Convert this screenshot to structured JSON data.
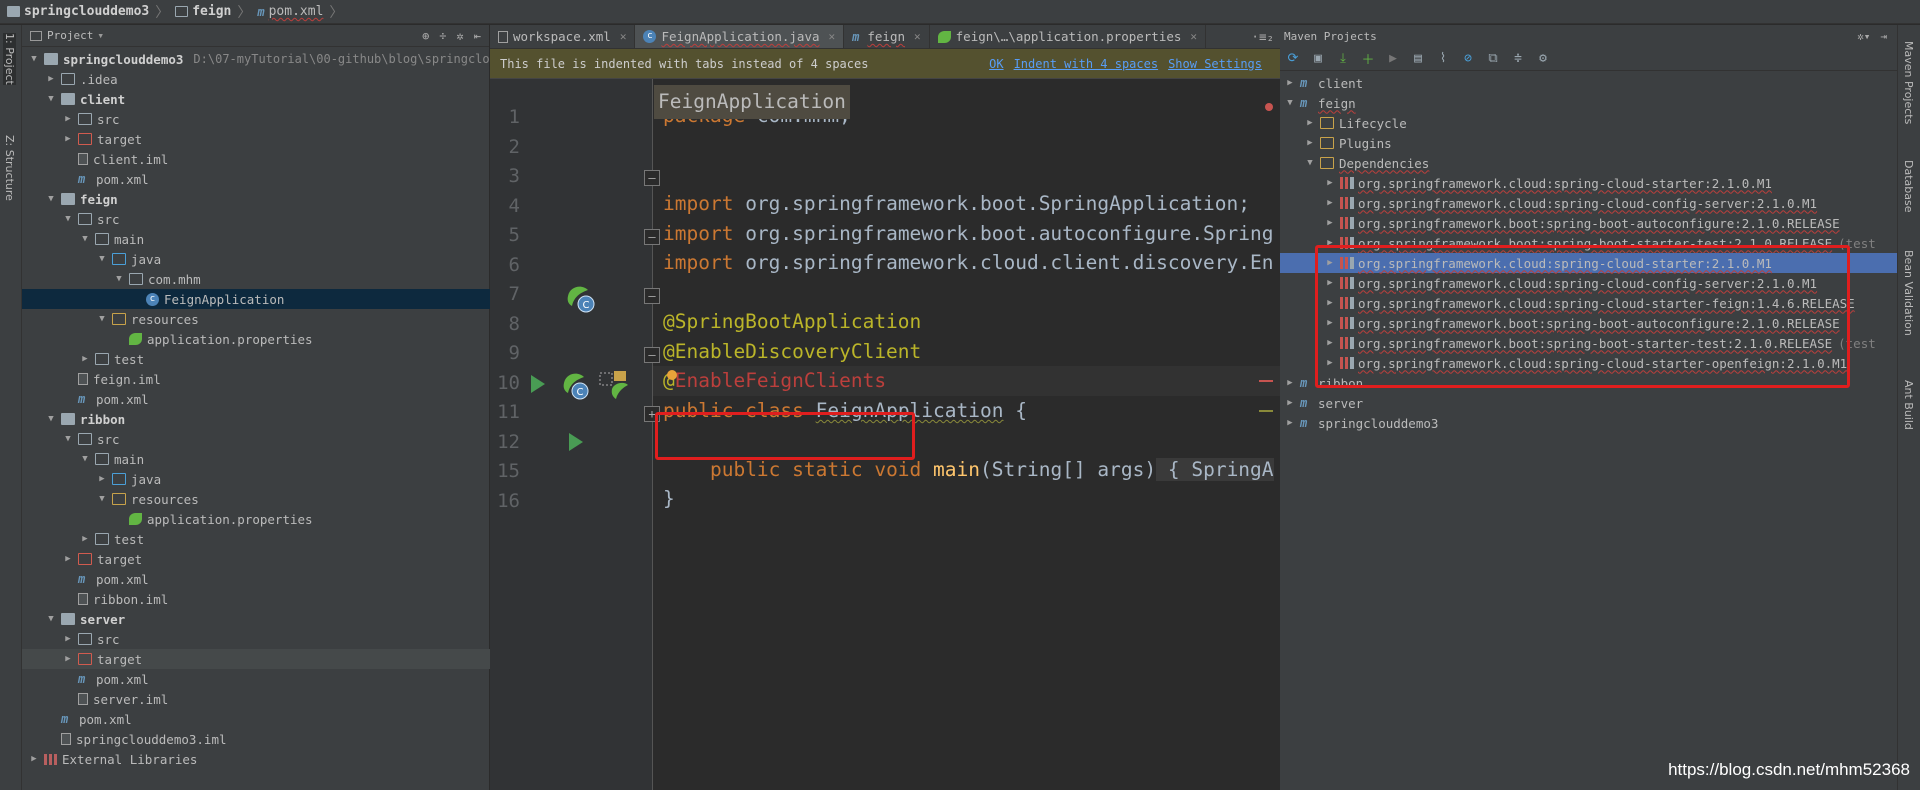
{
  "breadcrumb": [
    {
      "label": "springclouddemo3",
      "icon": "folder-icon"
    },
    {
      "label": "feign",
      "icon": "module-folder-icon"
    },
    {
      "label": "pom.xml",
      "icon": "maven-icon"
    }
  ],
  "left_stripe": {
    "project_tab": "1: Project",
    "structure_tab": "Z: Structure"
  },
  "project_panel": {
    "title": "Project",
    "root_path": "D:\\07-myTutorial\\00-github\\blog\\springclo",
    "rows": [
      {
        "label": "springclouddemo3",
        "bold": true,
        "arrow": "down",
        "icon": "module"
      },
      {
        "label": ".idea",
        "arrow": "right",
        "icon": "normal"
      },
      {
        "label": "client",
        "bold": true,
        "arrow": "down",
        "icon": "module"
      },
      {
        "label": "src",
        "arrow": "right",
        "icon": "normal"
      },
      {
        "label": "target",
        "arrow": "right",
        "icon": "target"
      },
      {
        "label": "client.iml",
        "icon": "iml"
      },
      {
        "label": "pom.xml",
        "icon": "mvn"
      },
      {
        "label": "feign",
        "bold": true,
        "arrow": "down",
        "icon": "module"
      },
      {
        "label": "src",
        "arrow": "down",
        "icon": "normal"
      },
      {
        "label": "main",
        "arrow": "down",
        "icon": "normal"
      },
      {
        "label": "java",
        "arrow": "down",
        "icon": "src"
      },
      {
        "label": "com.mhm",
        "arrow": "down",
        "icon": "normal"
      },
      {
        "label": "FeignApplication",
        "icon": "class"
      },
      {
        "label": "resources",
        "arrow": "down",
        "icon": "res"
      },
      {
        "label": "application.properties",
        "icon": "leaf"
      },
      {
        "label": "test",
        "arrow": "right",
        "icon": "test"
      },
      {
        "label": "feign.iml",
        "icon": "iml"
      },
      {
        "label": "pom.xml",
        "icon": "mvn"
      },
      {
        "label": "ribbon",
        "bold": true,
        "arrow": "down",
        "icon": "module"
      },
      {
        "label": "src",
        "arrow": "down",
        "icon": "normal"
      },
      {
        "label": "main",
        "arrow": "down",
        "icon": "normal"
      },
      {
        "label": "java",
        "arrow": "right",
        "icon": "src"
      },
      {
        "label": "resources",
        "arrow": "down",
        "icon": "res"
      },
      {
        "label": "application.properties",
        "icon": "leaf"
      },
      {
        "label": "test",
        "arrow": "right",
        "icon": "test"
      },
      {
        "label": "target",
        "arrow": "right",
        "icon": "target"
      },
      {
        "label": "pom.xml",
        "icon": "mvn"
      },
      {
        "label": "ribbon.iml",
        "icon": "iml"
      },
      {
        "label": "server",
        "bold": true,
        "arrow": "down",
        "icon": "module"
      },
      {
        "label": "src",
        "arrow": "right",
        "icon": "normal"
      },
      {
        "label": "target",
        "arrow": "right",
        "icon": "target"
      },
      {
        "label": "pom.xml",
        "icon": "mvn"
      },
      {
        "label": "server.iml",
        "icon": "iml"
      },
      {
        "label": "pom.xml",
        "icon": "mvn"
      },
      {
        "label": "springclouddemo3.iml",
        "icon": "iml"
      },
      {
        "label": "External Libraries",
        "arrow": "right",
        "icon": "lib"
      }
    ]
  },
  "editor": {
    "tabs": [
      {
        "label": "workspace.xml",
        "icon": "xml-icon",
        "active": false
      },
      {
        "label": "FeignApplication.java",
        "icon": "class-icon",
        "active": true
      },
      {
        "label": "feign",
        "icon": "maven-icon",
        "active": false
      },
      {
        "label": "feign\\…\\application.properties",
        "icon": "leaf-icon",
        "active": false
      }
    ],
    "tab_more": "·≡₂",
    "notice": {
      "text": "This file is indented with tabs instead of 4 spaces",
      "ok": "OK",
      "indent": "Indent with 4 spaces",
      "settings": "Show Settings"
    },
    "file_label": "FeignApplication",
    "line_numbers": [
      "1",
      "2",
      "3",
      "4",
      "5",
      "6",
      "7",
      "8",
      "9",
      "10",
      "11",
      "12",
      "15",
      "16"
    ],
    "code": {
      "l1_kw": "package",
      "l1_rest": " com.mhm;",
      "l3_kw": "import",
      "l3_rest": " org.springframework.boot.SpringApplication;",
      "l4_kw": "import",
      "l4_rest": " org.springframework.boot.autoconfigure.Spring",
      "l5_kw": "import",
      "l5_rest": " org.springframework.cloud.client.discovery.En",
      "l7": "@SpringBootApplication",
      "l8": "@EnableDiscoveryClient",
      "l9_at": "@",
      "l9_rest": "EnableFeignClients",
      "l10_kw": "public class",
      "l10_name": "FeignApplication",
      "l10_brace": " {",
      "l12_kw": "public static void",
      "l12_fn": "main",
      "l12_args": "(String[] args)",
      "l12_body": " { SpringA",
      "l15": "}"
    }
  },
  "maven_panel": {
    "title": "Maven Projects",
    "rows": [
      {
        "label": "client",
        "arrow": "right",
        "icon": "mvn",
        "indent": 0
      },
      {
        "label": "feign",
        "arrow": "down",
        "icon": "mvn",
        "indent": 0
      },
      {
        "label": "Lifecycle",
        "arrow": "right",
        "icon": "folder",
        "indent": 1
      },
      {
        "label": "Plugins",
        "arrow": "right",
        "icon": "folder",
        "indent": 1
      },
      {
        "label": "Dependencies",
        "arrow": "down",
        "icon": "folder",
        "indent": 1
      },
      {
        "label": "org.springframework.cloud:spring-cloud-starter:2.1.0.M1",
        "arrow": "right",
        "icon": "dep",
        "indent": 2
      },
      {
        "label": "org.springframework.cloud:spring-cloud-config-server:2.1.0.M1",
        "arrow": "right",
        "icon": "dep",
        "indent": 2
      },
      {
        "label": "org.springframework.boot:spring-boot-autoconfigure:2.1.0.RELEASE",
        "arrow": "right",
        "icon": "dep",
        "indent": 2
      },
      {
        "label": "org.springframework.boot:spring-boot-starter-test:2.1.0.RELEASE",
        "scope": "(test",
        "arrow": "right",
        "icon": "dep",
        "indent": 2
      },
      {
        "label": "org.springframework.cloud:spring-cloud-starter:2.1.0.M1",
        "arrow": "right",
        "icon": "dep",
        "indent": 2,
        "selected": true
      },
      {
        "label": "org.springframework.cloud:spring-cloud-config-server:2.1.0.M1",
        "arrow": "right",
        "icon": "dep",
        "indent": 2
      },
      {
        "label": "org.springframework.cloud:spring-cloud-starter-feign:1.4.6.RELEASE",
        "arrow": "right",
        "icon": "dep",
        "indent": 2
      },
      {
        "label": "org.springframework.boot:spring-boot-autoconfigure:2.1.0.RELEASE",
        "arrow": "right",
        "icon": "dep",
        "indent": 2
      },
      {
        "label": "org.springframework.boot:spring-boot-starter-test:2.1.0.RELEASE",
        "scope": "(test",
        "arrow": "right",
        "icon": "dep",
        "indent": 2
      },
      {
        "label": "org.springframework.cloud:spring-cloud-starter-openfeign:2.1.0.M1",
        "arrow": "right",
        "icon": "dep",
        "indent": 2
      },
      {
        "label": "ribbon",
        "arrow": "right",
        "icon": "mvn",
        "indent": 0
      },
      {
        "label": "server",
        "arrow": "right",
        "icon": "mvn",
        "indent": 0
      },
      {
        "label": "springclouddemo3",
        "arrow": "right",
        "icon": "mvn",
        "indent": 0
      }
    ]
  },
  "right_stripe": {
    "maven": "Maven Projects",
    "database": "Database",
    "bean": "Bean Validation",
    "ant": "Ant Build"
  },
  "watermark": "https://blog.csdn.net/mhm52368",
  "colors": {
    "selection": "#4b6eaf",
    "highlight_box": "#e01e1e",
    "keyword": "#cc7832",
    "annotation": "#bbb529"
  }
}
